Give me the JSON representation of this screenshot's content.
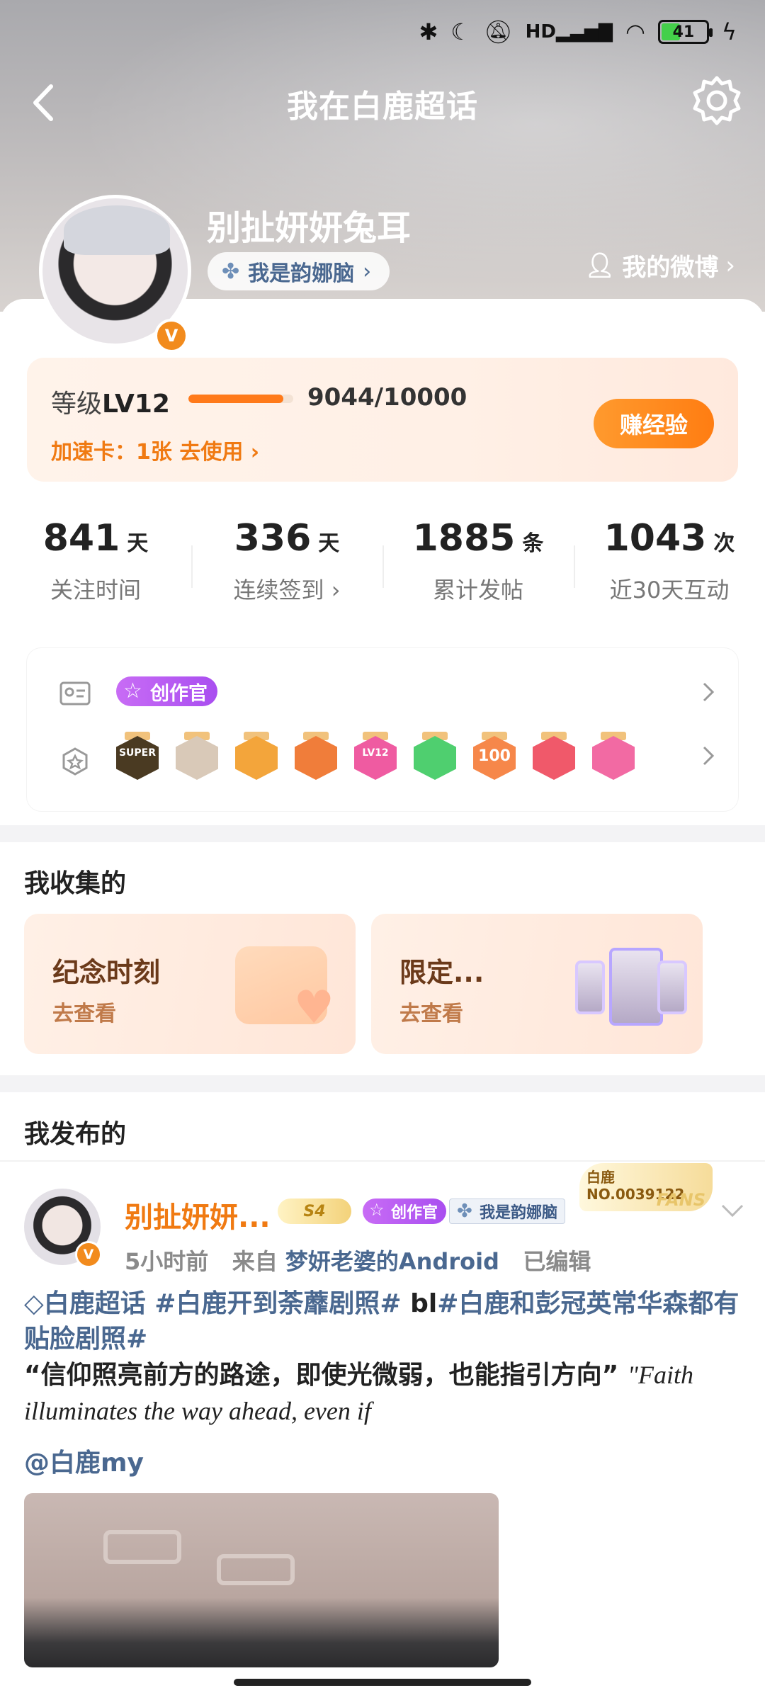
{
  "status_bar": {
    "battery": "41"
  },
  "header": {
    "title": "我在白鹿超话"
  },
  "profile": {
    "username": "别扯妍妍兔耳",
    "group": "我是韵娜脑",
    "my_weibo": "我的微博",
    "verified_mark": "V"
  },
  "level": {
    "label_prefix": "等级",
    "level": "LV12",
    "progress": "9044/10000",
    "progress_fraction": 0.9044,
    "speed_card": "加速卡：1张 去使用",
    "earn_button": "赚经验"
  },
  "stats": [
    {
      "value": "841",
      "unit": "天",
      "label": "关注时间"
    },
    {
      "value": "336",
      "unit": "天",
      "label": "连续签到"
    },
    {
      "value": "1885",
      "unit": "条",
      "label": "累计发帖"
    },
    {
      "value": "1043",
      "unit": "次",
      "label": "近30天互动"
    }
  ],
  "badges": {
    "creator_tag": "创作官",
    "medals": [
      {
        "name": "super-medal",
        "color": "#4a3a22",
        "text": "SUPER"
      },
      {
        "name": "avatar-medal",
        "color": "#d9c9b8",
        "text": ""
      },
      {
        "name": "crown-medal",
        "color": "#f3a53b",
        "text": ""
      },
      {
        "name": "tiger-medal",
        "color": "#f07d3a",
        "text": ""
      },
      {
        "name": "lv12-medal",
        "color": "#ef5ba1",
        "text": "LV12"
      },
      {
        "name": "leaf-medal",
        "color": "#4fcf6f",
        "text": ""
      },
      {
        "name": "100-days-medal",
        "color": "#f6874a",
        "text": "100"
      },
      {
        "name": "trophy-medal",
        "color": "#f0596a",
        "text": ""
      },
      {
        "name": "cap-medal",
        "color": "#f26aa3",
        "text": ""
      }
    ]
  },
  "collections": {
    "title": "我收集的",
    "cards": [
      {
        "title": "纪念时刻",
        "sub": "去查看"
      },
      {
        "title": "限定...",
        "sub": "去查看"
      }
    ]
  },
  "posts": {
    "title": "我发布的",
    "author": "别扯妍妍...",
    "level_badge": "S4",
    "creator_tag": "创作官",
    "group_tag": "我是韵娜脑",
    "fans_name": "白鹿",
    "fans_no": "NO.0039122",
    "fans_word": "FANS",
    "time": "5小时前",
    "from_prefix": "来自",
    "source": "梦妍老婆的Android",
    "edited": "已编辑",
    "topic_line": "白鹿超话 #白鹿开到荼蘼剧照# bl#白鹿和彭冠英常华森都有贴脸剧照#",
    "topic_a": "白鹿超话",
    "topic_b": "#白鹿开到荼蘼剧照#",
    "topic_c_prefix": "bl",
    "topic_c": "#白鹿和彭冠英常华森都有贴脸剧照#",
    "quote_cn": "“信仰照亮前方的路途，即使光微弱，也能指引方向”",
    "quote_en": "\"Faith illuminates the way ahead, even if",
    "mention": "@白鹿my"
  }
}
